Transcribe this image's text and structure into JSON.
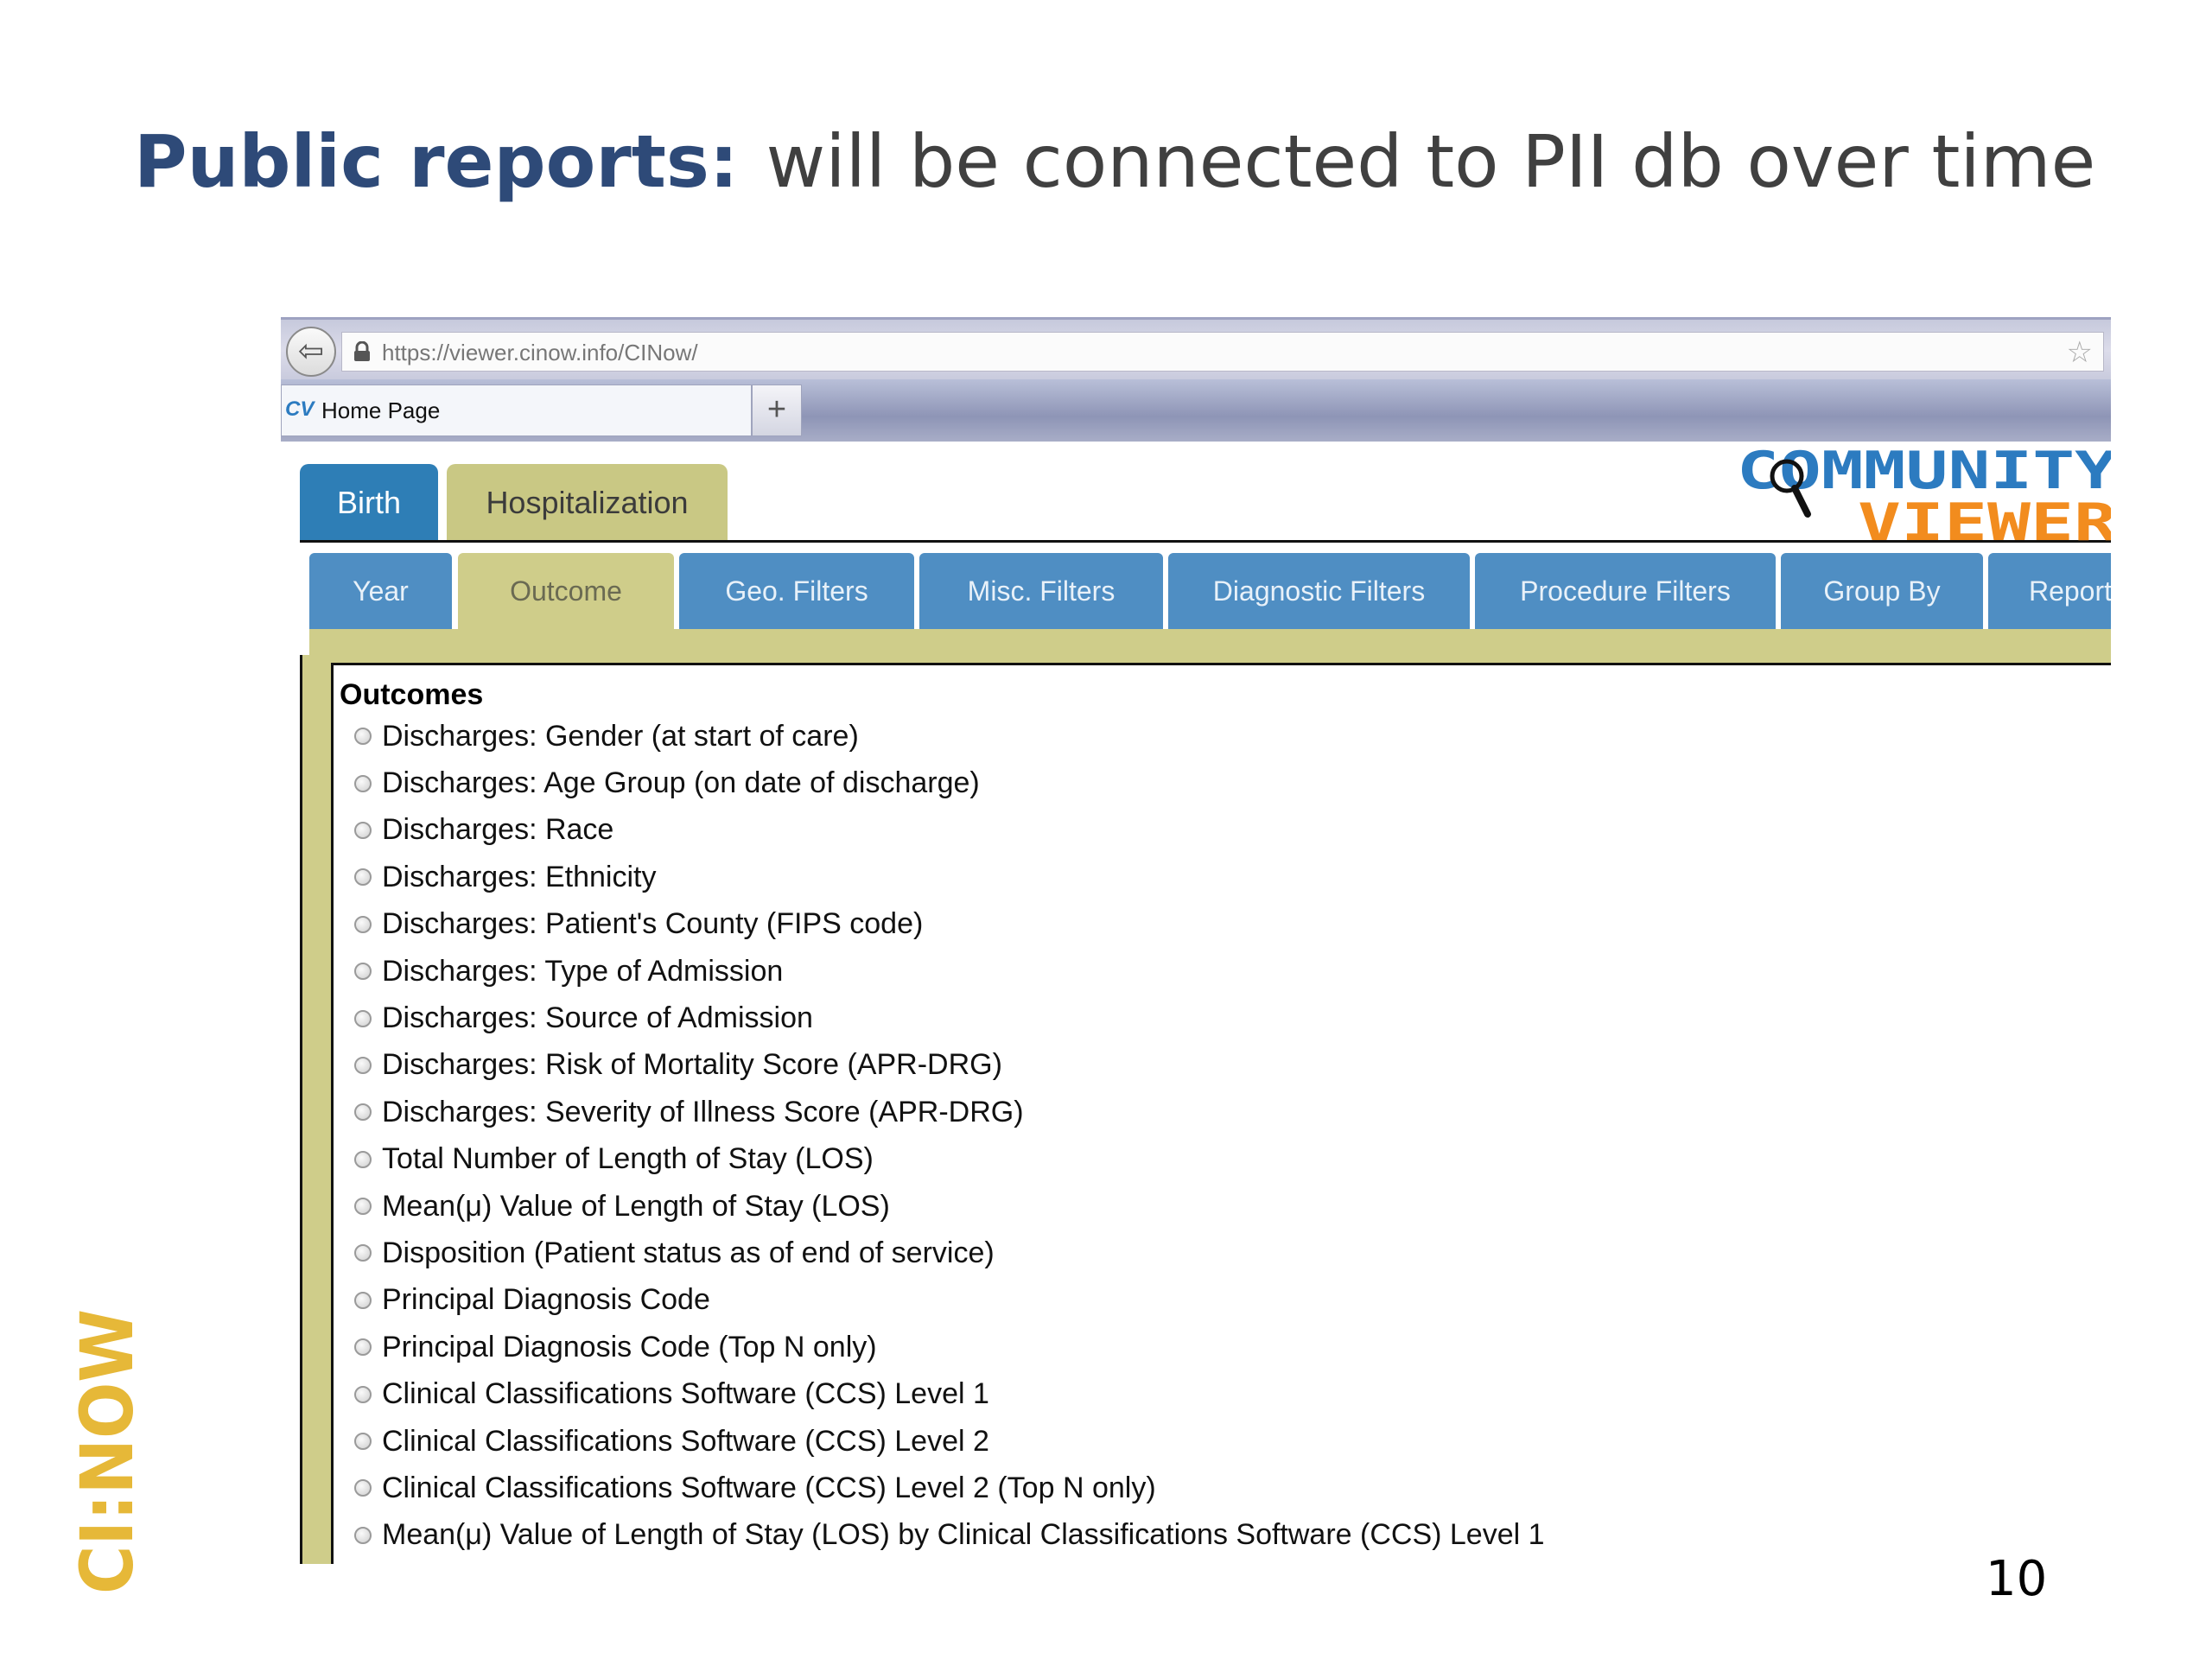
{
  "slide": {
    "title_strong": "Public reports:",
    "title_rest": "will be connected to PII db over time",
    "page_number": "10",
    "side_logo": "CI:NOW"
  },
  "browser": {
    "url": "https://viewer.cinow.info/CINow/",
    "tab_icon": "CV",
    "tab_title": "Home Page",
    "new_tab": "+"
  },
  "app": {
    "logo_line1": "COMMUNITY",
    "logo_line2": "VIEWER",
    "main_tabs": [
      {
        "label": "Birth"
      },
      {
        "label": "Hospitalization"
      }
    ],
    "sub_tabs": [
      {
        "label": "Year"
      },
      {
        "label": "Outcome"
      },
      {
        "label": "Geo. Filters"
      },
      {
        "label": "Misc. Filters"
      },
      {
        "label": "Diagnostic Filters"
      },
      {
        "label": "Procedure Filters"
      },
      {
        "label": "Group By"
      },
      {
        "label": "Report"
      }
    ],
    "outcomes_heading": "Outcomes",
    "outcomes": [
      "Discharges: Gender (at start of care)",
      "Discharges: Age Group (on date of discharge)",
      "Discharges: Race",
      "Discharges: Ethnicity",
      "Discharges: Patient's County (FIPS code)",
      "Discharges: Type of Admission",
      "Discharges: Source of Admission",
      "Discharges: Risk of Mortality Score (APR-DRG)",
      "Discharges: Severity of Illness Score (APR-DRG)",
      "Total Number of Length of Stay (LOS)",
      "Mean(μ) Value of Length of Stay (LOS)",
      "Disposition (Patient status as of end of service)",
      "Principal Diagnosis Code",
      "Principal Diagnosis Code (Top N only)",
      "Clinical Classifications Software (CCS) Level 1",
      "Clinical Classifications Software (CCS) Level 2",
      "Clinical Classifications Software (CCS) Level 2 (Top N only)",
      "Mean(μ) Value of Length of Stay (LOS) by Clinical Classifications Software (CCS) Level 1"
    ]
  },
  "colors": {
    "title_blue": "#2e4a78",
    "tab_blue": "#4f8ec3",
    "tab_olive": "#cfcd8a",
    "logo_blue": "#2c7bc0",
    "logo_orange": "#f28c1e",
    "cinow_gold": "#e6b838"
  }
}
